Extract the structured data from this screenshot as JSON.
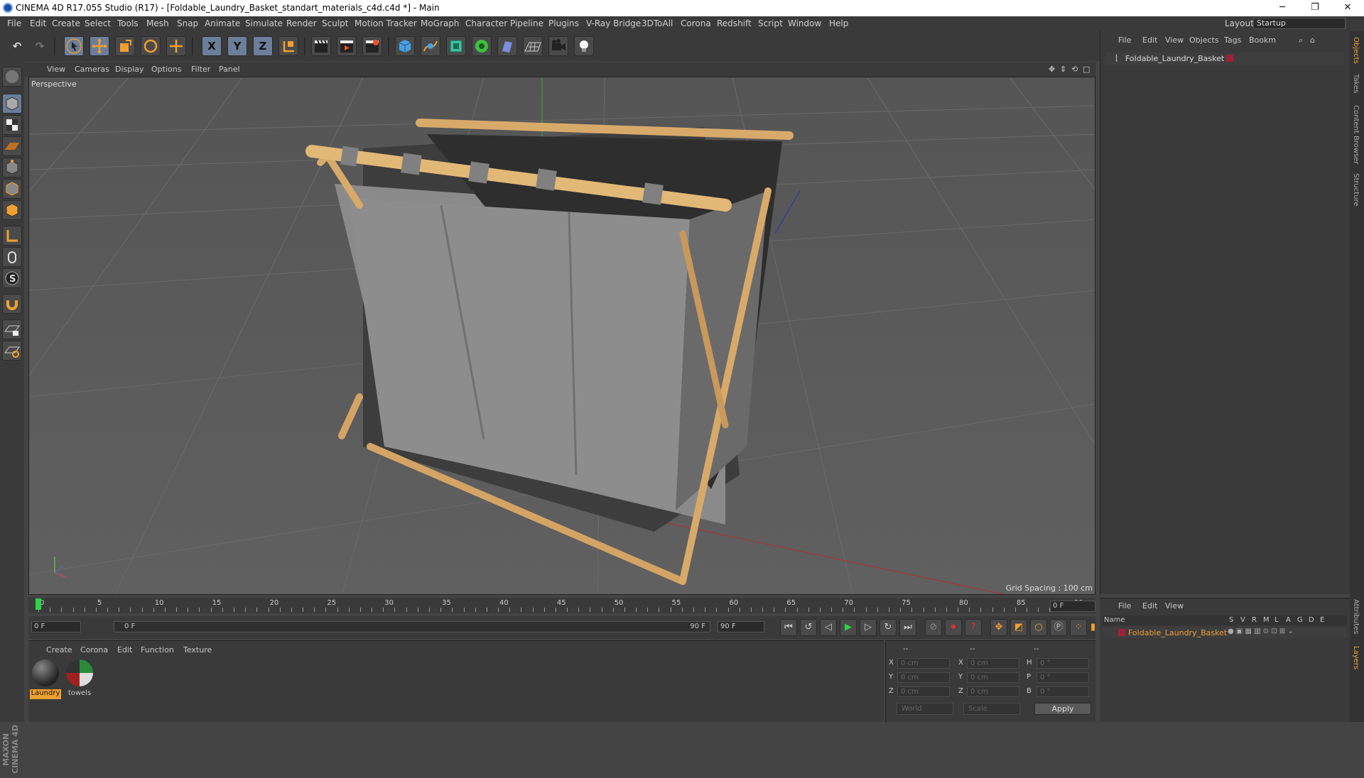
{
  "window": {
    "title": "CINEMA 4D R17.055 Studio (R17) - [Foldable_Laundry_Basket_standart_materials_c4d.c4d *] - Main",
    "min": "─",
    "restore": "❐",
    "close": "✕"
  },
  "menubar": {
    "items": [
      "File",
      "Edit",
      "Create",
      "Select",
      "Tools",
      "Mesh",
      "Snap",
      "Animate",
      "Simulate",
      "Render",
      "Sculpt",
      "Motion Tracker",
      "MoGraph",
      "Character",
      "Pipeline",
      "Plugins",
      "V-Ray Bridge",
      "3DToAll",
      "Corona",
      "Redshift",
      "Script",
      "Window",
      "Help"
    ],
    "layout_label": "Layout:",
    "layout_value": "Startup"
  },
  "toolbar": {
    "undo": "↶",
    "redo": "↷",
    "axis_x": "X",
    "axis_y": "Y",
    "axis_z": "Z"
  },
  "viewport": {
    "menu": [
      "View",
      "Cameras",
      "Display",
      "Options",
      "Filter",
      "Panel"
    ],
    "label": "Perspective",
    "grid_spacing": "Grid Spacing : 100 cm"
  },
  "objects_panel": {
    "menu": [
      "File",
      "Edit",
      "View",
      "Objects",
      "Tags",
      "Bookm"
    ],
    "object_name": "Foldable_Laundry_Basket",
    "tag_color": "#a0203a"
  },
  "side_tabs": [
    "Objects",
    "Takes",
    "Content Browser",
    "Structure",
    "Attributes",
    "Layers"
  ],
  "timeline": {
    "ticks": [
      "0",
      "5",
      "10",
      "15",
      "20",
      "25",
      "30",
      "35",
      "40",
      "45",
      "50",
      "55",
      "60",
      "65",
      "70",
      "75",
      "80",
      "85",
      "90"
    ],
    "current_frame": "0 F",
    "start": "0 F",
    "slider_left": "0 F",
    "slider_right": "90 F",
    "end": "90 F"
  },
  "materials": {
    "menu": [
      "Create",
      "Corona",
      "Edit",
      "Function",
      "Texture"
    ],
    "items": [
      {
        "name": "Laundry"
      },
      {
        "name": "towels"
      }
    ]
  },
  "coordinates": {
    "header": [
      "--",
      "--",
      "--"
    ],
    "rows": [
      {
        "a": "X",
        "av": "0 cm",
        "b": "X",
        "bv": "0 cm",
        "c": "H",
        "cv": "0 °"
      },
      {
        "a": "Y",
        "av": "0 cm",
        "b": "Y",
        "bv": "0 cm",
        "c": "P",
        "cv": "0 °"
      },
      {
        "a": "Z",
        "av": "0 cm",
        "b": "Z",
        "bv": "0 cm",
        "c": "B",
        "cv": "0 °"
      }
    ],
    "mode": "World",
    "transform": "Scale",
    "apply": "Apply"
  },
  "layers_panel": {
    "menu": [
      "File",
      "Edit",
      "View"
    ],
    "col_name": "Name",
    "cols": [
      "S",
      "V",
      "R",
      "M",
      "L",
      "A",
      "G",
      "D",
      "E"
    ],
    "row_name": "Foldable_Laundry_Basket"
  },
  "branding": "MAXON CINEMA 4D",
  "accent": "#f0a030"
}
